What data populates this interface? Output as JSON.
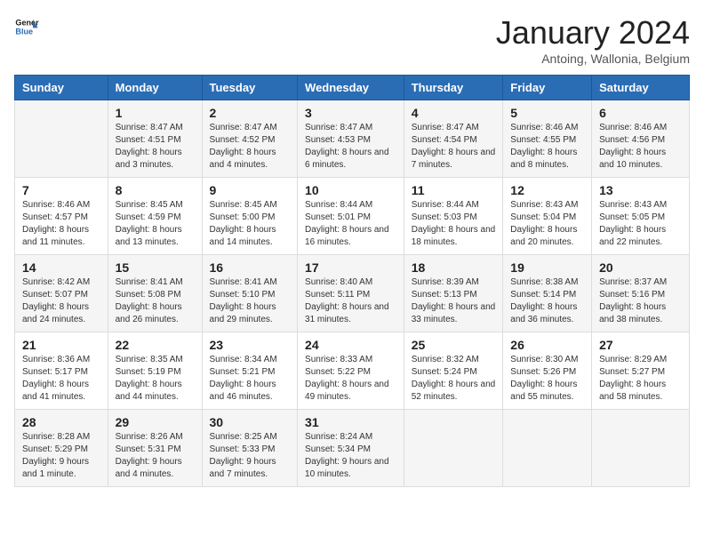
{
  "logo": {
    "line1": "General",
    "line2": "Blue"
  },
  "title": "January 2024",
  "subtitle": "Antoing, Wallonia, Belgium",
  "weekdays": [
    "Sunday",
    "Monday",
    "Tuesday",
    "Wednesday",
    "Thursday",
    "Friday",
    "Saturday"
  ],
  "weeks": [
    [
      {
        "day": "",
        "sunrise": "",
        "sunset": "",
        "daylight": ""
      },
      {
        "day": "1",
        "sunrise": "Sunrise: 8:47 AM",
        "sunset": "Sunset: 4:51 PM",
        "daylight": "Daylight: 8 hours and 3 minutes."
      },
      {
        "day": "2",
        "sunrise": "Sunrise: 8:47 AM",
        "sunset": "Sunset: 4:52 PM",
        "daylight": "Daylight: 8 hours and 4 minutes."
      },
      {
        "day": "3",
        "sunrise": "Sunrise: 8:47 AM",
        "sunset": "Sunset: 4:53 PM",
        "daylight": "Daylight: 8 hours and 6 minutes."
      },
      {
        "day": "4",
        "sunrise": "Sunrise: 8:47 AM",
        "sunset": "Sunset: 4:54 PM",
        "daylight": "Daylight: 8 hours and 7 minutes."
      },
      {
        "day": "5",
        "sunrise": "Sunrise: 8:46 AM",
        "sunset": "Sunset: 4:55 PM",
        "daylight": "Daylight: 8 hours and 8 minutes."
      },
      {
        "day": "6",
        "sunrise": "Sunrise: 8:46 AM",
        "sunset": "Sunset: 4:56 PM",
        "daylight": "Daylight: 8 hours and 10 minutes."
      }
    ],
    [
      {
        "day": "7",
        "sunrise": "Sunrise: 8:46 AM",
        "sunset": "Sunset: 4:57 PM",
        "daylight": "Daylight: 8 hours and 11 minutes."
      },
      {
        "day": "8",
        "sunrise": "Sunrise: 8:45 AM",
        "sunset": "Sunset: 4:59 PM",
        "daylight": "Daylight: 8 hours and 13 minutes."
      },
      {
        "day": "9",
        "sunrise": "Sunrise: 8:45 AM",
        "sunset": "Sunset: 5:00 PM",
        "daylight": "Daylight: 8 hours and 14 minutes."
      },
      {
        "day": "10",
        "sunrise": "Sunrise: 8:44 AM",
        "sunset": "Sunset: 5:01 PM",
        "daylight": "Daylight: 8 hours and 16 minutes."
      },
      {
        "day": "11",
        "sunrise": "Sunrise: 8:44 AM",
        "sunset": "Sunset: 5:03 PM",
        "daylight": "Daylight: 8 hours and 18 minutes."
      },
      {
        "day": "12",
        "sunrise": "Sunrise: 8:43 AM",
        "sunset": "Sunset: 5:04 PM",
        "daylight": "Daylight: 8 hours and 20 minutes."
      },
      {
        "day": "13",
        "sunrise": "Sunrise: 8:43 AM",
        "sunset": "Sunset: 5:05 PM",
        "daylight": "Daylight: 8 hours and 22 minutes."
      }
    ],
    [
      {
        "day": "14",
        "sunrise": "Sunrise: 8:42 AM",
        "sunset": "Sunset: 5:07 PM",
        "daylight": "Daylight: 8 hours and 24 minutes."
      },
      {
        "day": "15",
        "sunrise": "Sunrise: 8:41 AM",
        "sunset": "Sunset: 5:08 PM",
        "daylight": "Daylight: 8 hours and 26 minutes."
      },
      {
        "day": "16",
        "sunrise": "Sunrise: 8:41 AM",
        "sunset": "Sunset: 5:10 PM",
        "daylight": "Daylight: 8 hours and 29 minutes."
      },
      {
        "day": "17",
        "sunrise": "Sunrise: 8:40 AM",
        "sunset": "Sunset: 5:11 PM",
        "daylight": "Daylight: 8 hours and 31 minutes."
      },
      {
        "day": "18",
        "sunrise": "Sunrise: 8:39 AM",
        "sunset": "Sunset: 5:13 PM",
        "daylight": "Daylight: 8 hours and 33 minutes."
      },
      {
        "day": "19",
        "sunrise": "Sunrise: 8:38 AM",
        "sunset": "Sunset: 5:14 PM",
        "daylight": "Daylight: 8 hours and 36 minutes."
      },
      {
        "day": "20",
        "sunrise": "Sunrise: 8:37 AM",
        "sunset": "Sunset: 5:16 PM",
        "daylight": "Daylight: 8 hours and 38 minutes."
      }
    ],
    [
      {
        "day": "21",
        "sunrise": "Sunrise: 8:36 AM",
        "sunset": "Sunset: 5:17 PM",
        "daylight": "Daylight: 8 hours and 41 minutes."
      },
      {
        "day": "22",
        "sunrise": "Sunrise: 8:35 AM",
        "sunset": "Sunset: 5:19 PM",
        "daylight": "Daylight: 8 hours and 44 minutes."
      },
      {
        "day": "23",
        "sunrise": "Sunrise: 8:34 AM",
        "sunset": "Sunset: 5:21 PM",
        "daylight": "Daylight: 8 hours and 46 minutes."
      },
      {
        "day": "24",
        "sunrise": "Sunrise: 8:33 AM",
        "sunset": "Sunset: 5:22 PM",
        "daylight": "Daylight: 8 hours and 49 minutes."
      },
      {
        "day": "25",
        "sunrise": "Sunrise: 8:32 AM",
        "sunset": "Sunset: 5:24 PM",
        "daylight": "Daylight: 8 hours and 52 minutes."
      },
      {
        "day": "26",
        "sunrise": "Sunrise: 8:30 AM",
        "sunset": "Sunset: 5:26 PM",
        "daylight": "Daylight: 8 hours and 55 minutes."
      },
      {
        "day": "27",
        "sunrise": "Sunrise: 8:29 AM",
        "sunset": "Sunset: 5:27 PM",
        "daylight": "Daylight: 8 hours and 58 minutes."
      }
    ],
    [
      {
        "day": "28",
        "sunrise": "Sunrise: 8:28 AM",
        "sunset": "Sunset: 5:29 PM",
        "daylight": "Daylight: 9 hours and 1 minute."
      },
      {
        "day": "29",
        "sunrise": "Sunrise: 8:26 AM",
        "sunset": "Sunset: 5:31 PM",
        "daylight": "Daylight: 9 hours and 4 minutes."
      },
      {
        "day": "30",
        "sunrise": "Sunrise: 8:25 AM",
        "sunset": "Sunset: 5:33 PM",
        "daylight": "Daylight: 9 hours and 7 minutes."
      },
      {
        "day": "31",
        "sunrise": "Sunrise: 8:24 AM",
        "sunset": "Sunset: 5:34 PM",
        "daylight": "Daylight: 9 hours and 10 minutes."
      },
      {
        "day": "",
        "sunrise": "",
        "sunset": "",
        "daylight": ""
      },
      {
        "day": "",
        "sunrise": "",
        "sunset": "",
        "daylight": ""
      },
      {
        "day": "",
        "sunrise": "",
        "sunset": "",
        "daylight": ""
      }
    ]
  ]
}
